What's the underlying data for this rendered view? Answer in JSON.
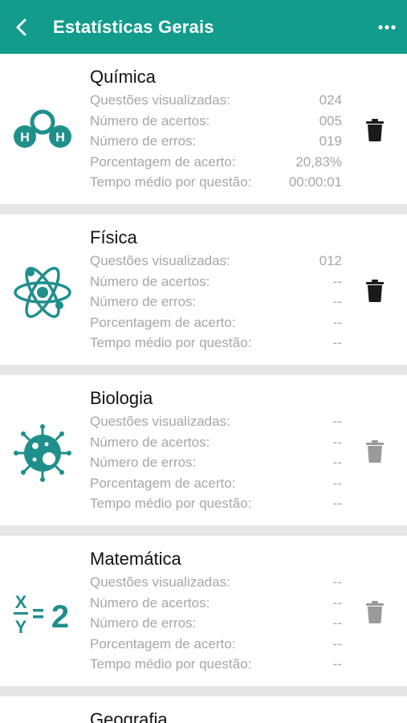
{
  "header": {
    "title": "Estatísticas Gerais",
    "back_icon": "chevron-left-icon",
    "menu_icon": "more-horizontal-icon",
    "background": "#119c8c"
  },
  "labels": {
    "viewed": "Questões visualizadas:",
    "correct": "Número de acertos:",
    "errors": "Número de erros:",
    "percent": "Porcentagem de acerto:",
    "avg_time": "Tempo médio por questão:"
  },
  "subjects": [
    {
      "name": "Química",
      "icon": "h2o-molecule-icon",
      "viewed": "024",
      "correct": "005",
      "errors": "019",
      "percent": "20,83%",
      "avg_time": "00:00:01",
      "delete_enabled": true
    },
    {
      "name": "Física",
      "icon": "atom-icon",
      "viewed": "012",
      "correct": "--",
      "errors": "--",
      "percent": "--",
      "avg_time": "--",
      "delete_enabled": true
    },
    {
      "name": "Biologia",
      "icon": "virus-cell-icon",
      "viewed": "--",
      "correct": "--",
      "errors": "--",
      "percent": "--",
      "avg_time": "--",
      "delete_enabled": false
    },
    {
      "name": "Matemática",
      "icon": "math-equation-icon",
      "viewed": "--",
      "correct": "--",
      "errors": "--",
      "percent": "--",
      "avg_time": "--",
      "delete_enabled": false
    },
    {
      "name": "Geografia"
    }
  ],
  "colors": {
    "accent": "#119c8c",
    "icon_teal": "#1f8f8c",
    "trash_active": "#1a1a1a",
    "trash_disabled": "#9a9a9a"
  }
}
